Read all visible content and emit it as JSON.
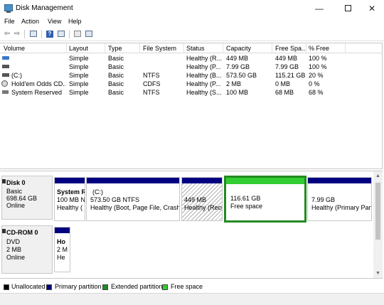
{
  "window": {
    "title": "Disk Management",
    "minimize": "—",
    "close": "✕"
  },
  "menu": {
    "items": [
      "File",
      "Action",
      "View",
      "Help"
    ]
  },
  "toolbar": {
    "back": "⇦",
    "forward": "⇨",
    "help_icon": "?"
  },
  "volume_list": {
    "columns": [
      "Volume",
      "Layout",
      "Type",
      "File System",
      "Status",
      "Capacity",
      "Free Spa...",
      "% Free"
    ],
    "rows": [
      {
        "volume": "",
        "layout": "Simple",
        "type": "Basic",
        "fs": "",
        "status": "Healthy (R...",
        "capacity": "449 MB",
        "free": "449 MB",
        "pct": "100 %",
        "icon": "drive-icon-blue"
      },
      {
        "volume": "",
        "layout": "Simple",
        "type": "Basic",
        "fs": "",
        "status": "Healthy (P...",
        "capacity": "7.99 GB",
        "free": "7.99 GB",
        "pct": "100 %",
        "icon": "drive-icon-dark"
      },
      {
        "volume": "(C:)",
        "layout": "Simple",
        "type": "Basic",
        "fs": "NTFS",
        "status": "Healthy (B...",
        "capacity": "573.50 GB",
        "free": "115.21 GB",
        "pct": "20 %",
        "icon": "drive-icon-dark"
      },
      {
        "volume": "Hold'em Odds CD...",
        "layout": "Simple",
        "type": "Basic",
        "fs": "CDFS",
        "status": "Healthy (P...",
        "capacity": "2 MB",
        "free": "0 MB",
        "pct": "0 %",
        "icon": "cd-icon"
      },
      {
        "volume": "System Reserved",
        "layout": "Simple",
        "type": "Basic",
        "fs": "NTFS",
        "status": "Healthy (S...",
        "capacity": "100 MB",
        "free": "68 MB",
        "pct": "68 %",
        "icon": "drive-icon-gray"
      }
    ]
  },
  "disks": [
    {
      "name": "Disk 0",
      "type": "Basic",
      "size": "698.64 GB",
      "state": "Online",
      "partitions": [
        {
          "name": "System R",
          "size": "100 MB N",
          "status": "Healthy (",
          "kind": "primary"
        },
        {
          "name": "(C:)",
          "size": "573.50 GB NTFS",
          "status": "Healthy (Boot, Page File, Crash D",
          "kind": "primary"
        },
        {
          "name": "",
          "size": "449 MB",
          "status": "Healthy (Reco",
          "kind": "recovery"
        },
        {
          "name": "",
          "size": "116.61 GB",
          "status": "Free space",
          "kind": "free"
        },
        {
          "name": "",
          "size": "7.99 GB",
          "status": "Healthy (Primary Part",
          "kind": "primary"
        }
      ]
    },
    {
      "name": "CD-ROM 0",
      "type": "DVD",
      "size": "2 MB",
      "state": "Online",
      "partitions": [
        {
          "name": "Ho",
          "size": "2 M",
          "status": "He",
          "kind": "primary"
        }
      ]
    }
  ],
  "legend": [
    {
      "label": "Unallocated",
      "color": "#000000"
    },
    {
      "label": "Primary partition",
      "color": "#000080"
    },
    {
      "label": "Extended partition",
      "color": "#228b22"
    },
    {
      "label": "Free space",
      "color": "#32cd32"
    }
  ]
}
